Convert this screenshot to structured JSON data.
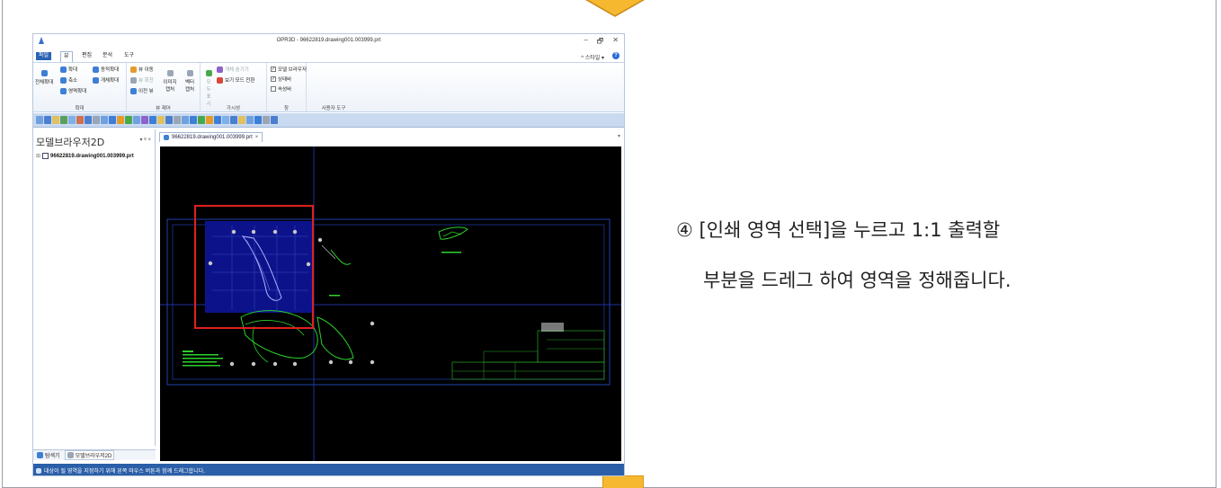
{
  "app": {
    "title": "OPR3D - 96622819.drawing001.003999.prt",
    "window_controls": [
      "–",
      "🗗",
      "✕"
    ],
    "menu": [
      "파일",
      "뷰",
      "편집",
      "분석",
      "도구"
    ],
    "active_menu": "뷰",
    "style_button": "^ 스타일 ▾",
    "help": "?"
  },
  "ribbon": {
    "groups": [
      {
        "label": "확대",
        "buttons": [
          "전체확대",
          "확대",
          "축소",
          "영역확대",
          "동적확대",
          "개체확대"
        ]
      },
      {
        "label": "뷰 제어",
        "buttons": [
          "뷰 이동",
          "뷰 회전",
          "이전 뷰",
          "이미지 캡처",
          "벡터 캡처"
        ]
      },
      {
        "label": "가시성",
        "buttons": [
          "개체 숨기기",
          "보기 모드 전환",
          "모두 표시"
        ]
      },
      {
        "label": "창",
        "checkboxes": [
          {
            "label": "모델 브라우저",
            "checked": true
          },
          {
            "label": "상태바",
            "checked": true
          },
          {
            "label": "속성바",
            "checked": false
          }
        ]
      },
      {
        "label": "사용자 도구",
        "buttons": []
      }
    ]
  },
  "left_panel": {
    "title": "모델브라우저2D",
    "controls": "▾ ᵠ ×",
    "tree": [
      {
        "label": "96622819.drawing001.003999.prt",
        "expander": "⊞"
      }
    ],
    "tabs": [
      "탐색기",
      "모델브라우저2D"
    ]
  },
  "document": {
    "tab_label": "96622819.drawing001.003999.prt",
    "tab_close": "×",
    "tab_dropdown": "▾"
  },
  "status": {
    "text": "대상이 될 영역을 지정하기 위해 왼쪽 마우스 버튼과 함께 드래그합니다."
  },
  "instruction": {
    "line1": "④ [인쇄 영역 선택]을 누르고 1:1 출력할",
    "line2": "부분을 드레그 하여 영역을 정해줍니다."
  },
  "colors": {
    "accent": "#2b63b5",
    "selection_box": "#e0201c",
    "selection_fill": "#0c138a",
    "drawing_lines": "#00c000",
    "frame_lines": "#1f3fb0",
    "tab_highlight": "#f5b82e"
  }
}
